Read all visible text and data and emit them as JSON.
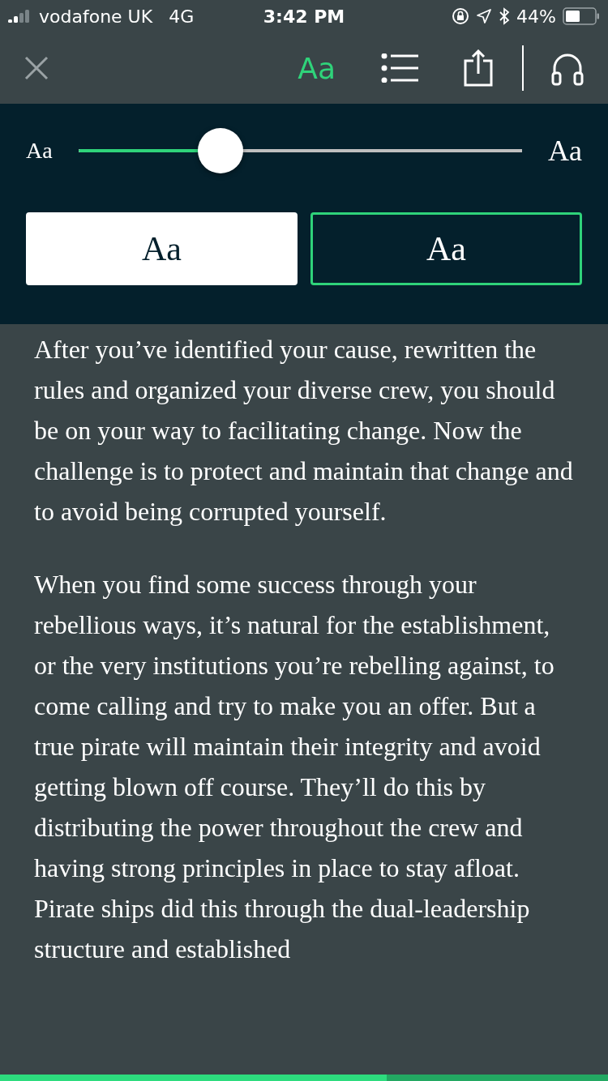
{
  "status_bar": {
    "carrier": "vodafone UK",
    "network": "4G",
    "time": "3:42 PM",
    "battery": "44%"
  },
  "toolbar": {
    "font_button": {
      "label": "Aa",
      "selected": true
    }
  },
  "font_panel": {
    "small_label": "Aa",
    "large_label": "Aa",
    "size_slider": {
      "level": 0.32
    },
    "themes": [
      {
        "kind": "light",
        "label": "Aa",
        "selected": false
      },
      {
        "kind": "dark",
        "label": "Aa",
        "selected": true
      }
    ]
  },
  "article": {
    "paragraphs": [
      "After you’ve identified your cause, rewritten the rules and organized your diverse crew, you should be on your way to facilitating change. Now the challenge is to protect and maintain that change and to avoid being corrupted yourself.",
      "When you find some success through your rebellious ways, it’s natural for the establishment, or the very institutions you’re rebelling against, to come calling and try to make you an offer. But a true pirate will maintain their integrity and avoid getting blown off course. They’ll do this by distributing the power throughout the crew and having strong principles in place to stay afloat. Pirate ships did this through the dual-leadership structure and established"
    ]
  },
  "progress": {
    "level": 0.636
  }
}
